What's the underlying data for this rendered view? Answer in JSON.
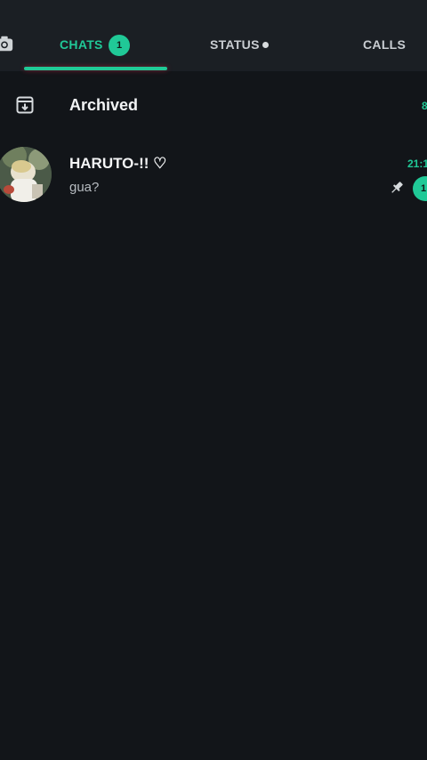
{
  "tabs": {
    "chats_label": "CHATS",
    "chats_badge": "1",
    "status_label": "STATUS",
    "calls_label": "CALLS",
    "active": "CHATS"
  },
  "archived": {
    "label": "Archived",
    "count": "8"
  },
  "chats": [
    {
      "name": "HARUTO-!! ♡",
      "preview": "gua?",
      "time": "21:1",
      "pinned": true,
      "unread": "1"
    }
  ],
  "icons": {
    "camera": "camera-icon",
    "archive": "archive-icon",
    "pin": "pin-icon"
  },
  "colors": {
    "accent": "#20c997",
    "background": "#121519",
    "tabbar": "#1b1f24"
  }
}
